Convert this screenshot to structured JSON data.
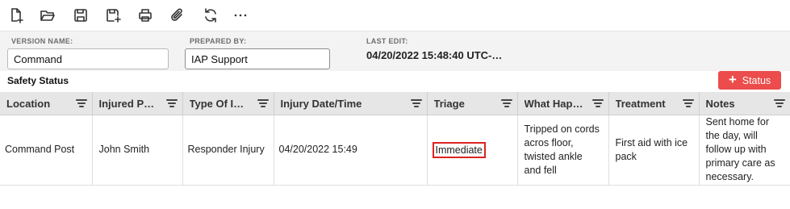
{
  "toolbar": {
    "icons": [
      "new-document-icon",
      "open-folder-icon",
      "save-icon",
      "save-as-icon",
      "print-icon",
      "attach-icon",
      "refresh-icon",
      "more-icon"
    ]
  },
  "form": {
    "version_name_label": "VERSION NAME:",
    "version_name_value": "Command",
    "prepared_by_label": "PREPARED BY:",
    "prepared_by_value": "IAP Support",
    "last_edit_label": "LAST EDIT:",
    "last_edit_value": "04/20/2022 15:48:40 UTC-…"
  },
  "section": {
    "title": "Safety Status",
    "status_button_label": "Status",
    "status_button_color": "#ec4c4c"
  },
  "table": {
    "columns": [
      "Location",
      "Injured P…",
      "Type Of I…",
      "Injury Date/Time",
      "Triage",
      "What Hap…",
      "Treatment",
      "Notes"
    ],
    "rows": [
      {
        "location": "Command Post",
        "injured_person": "John Smith",
        "type_of_injury": "Responder Injury",
        "injury_datetime": "04/20/2022 15:49",
        "triage": "Immediate",
        "what_happened": "Tripped on cords acros floor, twisted ankle and fell",
        "treatment": "First aid with ice pack",
        "notes": "Sent home for the day, will follow up with primary care as necessary."
      }
    ]
  }
}
